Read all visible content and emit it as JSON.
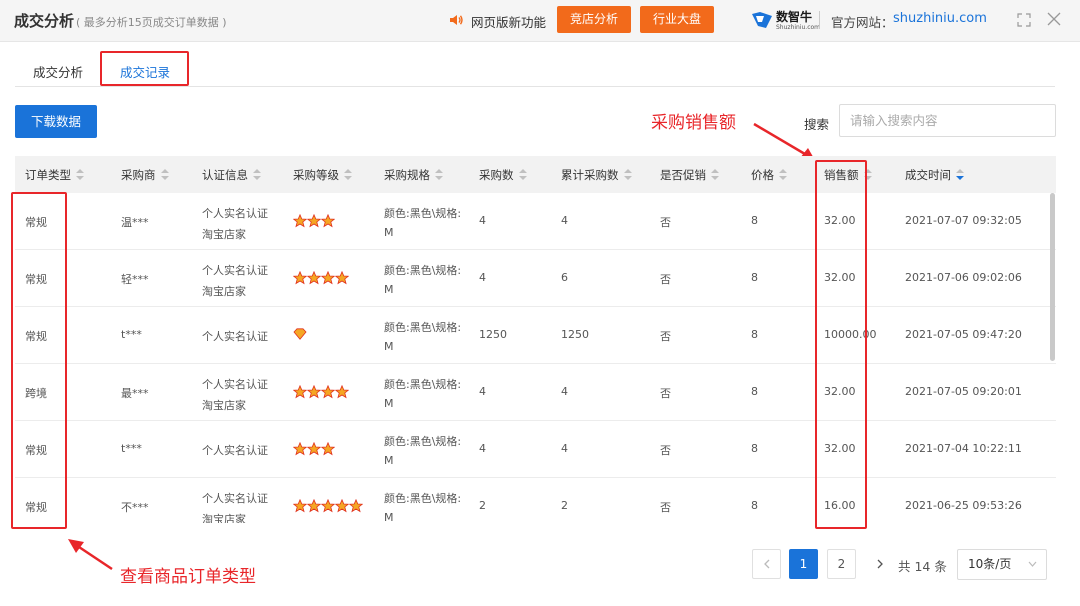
{
  "header": {
    "title": "成交分析",
    "subtitle": "( 最多分析15页成交订单数据 )",
    "new_feature": "网页版新功能",
    "btn_competitor": "竞店分析",
    "btn_industry": "行业大盘",
    "logo_name": "数智牛",
    "logo_sub": "Shuzhiniu.com",
    "site_label": "官方网站：",
    "site_url": "shuzhiniu.com"
  },
  "tabs": [
    {
      "label": "成交分析",
      "active": false
    },
    {
      "label": "成交记录",
      "active": true
    }
  ],
  "toolbar": {
    "download_label": "下载数据",
    "search_label": "搜索",
    "search_placeholder": "请输入搜索内容"
  },
  "annotations": {
    "sales_amount": "采购销售额",
    "order_type": "查看商品订单类型"
  },
  "table": {
    "columns": [
      "订单类型",
      "采购商",
      "认证信息",
      "采购等级",
      "采购规格",
      "采购数",
      "累计采购数",
      "是否促销",
      "价格",
      "销售额",
      "成交时间"
    ],
    "rows": [
      {
        "type": "常规",
        "buyer": "温***",
        "cert1": "个人实名认证",
        "cert2": "淘宝店家",
        "level": "3 stars",
        "level_count": 3,
        "spec1": "颜色:黑色\\规格:",
        "spec2": "M",
        "qty": "4",
        "total_qty": "4",
        "promo": "否",
        "price": "8",
        "amount": "32.00",
        "time": "2021-07-07 09:32:05"
      },
      {
        "type": "常规",
        "buyer": "轻***",
        "cert1": "个人实名认证",
        "cert2": "淘宝店家",
        "level": "4 stars",
        "level_count": 4,
        "spec1": "颜色:黑色\\规格:",
        "spec2": "M",
        "qty": "4",
        "total_qty": "6",
        "promo": "否",
        "price": "8",
        "amount": "32.00",
        "time": "2021-07-06 09:02:06"
      },
      {
        "type": "常规",
        "buyer": "t***",
        "cert1": "个人实名认证",
        "cert2": "",
        "level": "1 diamond",
        "level_count": 1,
        "spec1": "颜色:黑色\\规格:",
        "spec2": "M",
        "qty": "1250",
        "total_qty": "1250",
        "promo": "否",
        "price": "8",
        "amount": "10000.00",
        "time": "2021-07-05 09:47:20"
      },
      {
        "type": "跨境",
        "buyer": "最***",
        "cert1": "个人实名认证",
        "cert2": "淘宝店家",
        "level": "4 stars",
        "level_count": 4,
        "spec1": "颜色:黑色\\规格:",
        "spec2": "M",
        "qty": "4",
        "total_qty": "4",
        "promo": "否",
        "price": "8",
        "amount": "32.00",
        "time": "2021-07-05 09:20:01"
      },
      {
        "type": "常规",
        "buyer": "t***",
        "cert1": "个人实名认证",
        "cert2": "",
        "level": "3 stars",
        "level_count": 3,
        "spec1": "颜色:黑色\\规格:",
        "spec2": "M",
        "qty": "4",
        "total_qty": "4",
        "promo": "否",
        "price": "8",
        "amount": "32.00",
        "time": "2021-07-04 10:22:11"
      },
      {
        "type": "常规",
        "buyer": "不***",
        "cert1": "个人实名认证",
        "cert2": "淘宝店家",
        "level": "5 stars",
        "level_count": 5,
        "spec1": "颜色:黑色\\规格:",
        "spec2": "M",
        "qty": "2",
        "total_qty": "2",
        "promo": "否",
        "price": "8",
        "amount": "16.00",
        "time": "2021-06-25 09:53:26"
      }
    ]
  },
  "pagination": {
    "pages": [
      "1",
      "2"
    ],
    "current": "1",
    "total": "共 14 条",
    "page_size": "10条/页"
  },
  "colors": {
    "accent": "#1a73d9",
    "orange": "#f26a1b",
    "annotation_red": "#e8262a"
  }
}
